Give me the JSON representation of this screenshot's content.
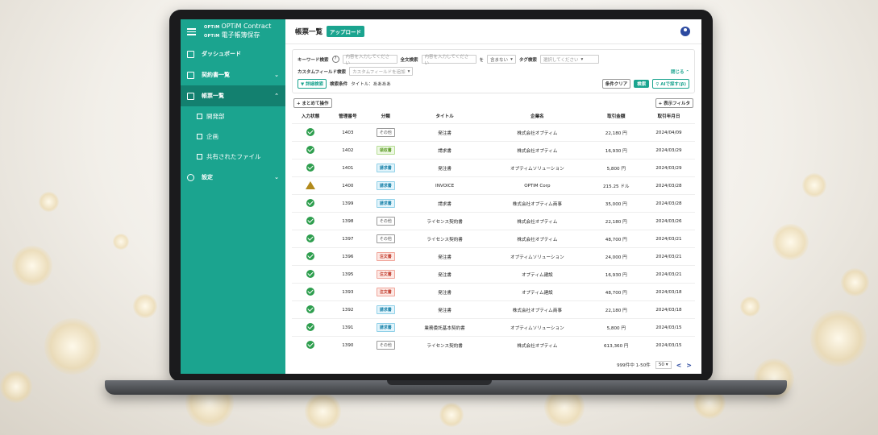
{
  "brand": {
    "logo_top": "OPTiM Contract",
    "logo_bottom": "電子帳簿保存",
    "prefix": "OPTiM"
  },
  "sidebar": {
    "items": [
      {
        "label": "ダッシュボード"
      },
      {
        "label": "契約書一覧"
      },
      {
        "label": "帳票一覧"
      },
      {
        "label": "設定"
      }
    ],
    "folders": [
      {
        "label": "開発部"
      },
      {
        "label": "企画"
      },
      {
        "label": "共有されたファイル"
      }
    ]
  },
  "header": {
    "title": "帳票一覧",
    "upload": "アップロード"
  },
  "search": {
    "keyword_label": "キーワード検索",
    "keyword_placeholder": "内容を入力してください",
    "fulltext_label": "全文検索",
    "fulltext_placeholder": "内容を入力してください",
    "wo": "を",
    "include_select": "含まない",
    "tag_label": "タグ検索",
    "tag_placeholder": "選択してください",
    "custom_label": "カスタムフィールド検索",
    "custom_placeholder": "カスタムフィールドを追加",
    "collapse": "閉じる",
    "advanced": "詳細検索",
    "conditions_label": "検索条件",
    "conditions_value": "タイトル：ああああ",
    "clear": "条件クリア",
    "search_btn": "検索",
    "ai_search": "AIで探す(β)"
  },
  "actions": {
    "bulk": "+ まとめて操作",
    "filter": "+ 表示フィルタ"
  },
  "table": {
    "headers": [
      "入力状態",
      "管理番号",
      "分類",
      "タイトル",
      "企業名",
      "取引金額",
      "取引年月日"
    ],
    "rows": [
      {
        "status": "ok",
        "id": "1403",
        "cat": "その他",
        "type": "other",
        "title": "発注書",
        "company": "株式会社オプティム",
        "amount": "22,180 円",
        "date": "2024/04/09"
      },
      {
        "status": "ok",
        "id": "1402",
        "cat": "領収書",
        "type": "receipt",
        "title": "請求書",
        "company": "株式会社オプティム",
        "amount": "16,930 円",
        "date": "2024/03/29"
      },
      {
        "status": "ok",
        "id": "1401",
        "cat": "請求書",
        "type": "bill",
        "title": "発注書",
        "company": "オプティムソリューション",
        "amount": "5,800 円",
        "date": "2024/03/29"
      },
      {
        "status": "warn",
        "id": "1400",
        "cat": "請求書",
        "type": "bill",
        "title": "INVOICE",
        "company": "OPTiM Corp",
        "amount": "215.25 ドル",
        "date": "2024/03/28"
      },
      {
        "status": "ok",
        "id": "1399",
        "cat": "請求書",
        "type": "bill",
        "title": "請求書",
        "company": "株式会社オプティム商事",
        "amount": "35,000 円",
        "date": "2024/03/28"
      },
      {
        "status": "ok",
        "id": "1398",
        "cat": "その他",
        "type": "other",
        "title": "ライセンス契約書",
        "company": "株式会社オプティム",
        "amount": "22,180 円",
        "date": "2024/03/26"
      },
      {
        "status": "ok",
        "id": "1397",
        "cat": "その他",
        "type": "other",
        "title": "ライセンス契約書",
        "company": "株式会社オプティム",
        "amount": "48,700 円",
        "date": "2024/03/21"
      },
      {
        "status": "ok",
        "id": "1396",
        "cat": "注文書",
        "type": "order",
        "title": "発注書",
        "company": "オプティムソリューション",
        "amount": "24,000 円",
        "date": "2024/03/21"
      },
      {
        "status": "ok",
        "id": "1395",
        "cat": "注文書",
        "type": "order",
        "title": "発注書",
        "company": "オプティム建設",
        "amount": "16,930 円",
        "date": "2024/03/21"
      },
      {
        "status": "ok",
        "id": "1393",
        "cat": "注文書",
        "type": "order",
        "title": "発注書",
        "company": "オプティム建設",
        "amount": "48,700 円",
        "date": "2024/03/18"
      },
      {
        "status": "ok",
        "id": "1392",
        "cat": "請求書",
        "type": "bill",
        "title": "発注書",
        "company": "株式会社オプティム商事",
        "amount": "22,180 円",
        "date": "2024/03/18"
      },
      {
        "status": "ok",
        "id": "1391",
        "cat": "請求書",
        "type": "bill",
        "title": "業務委託基本契約書",
        "company": "オプティムソリューション",
        "amount": "5,800 円",
        "date": "2024/03/15"
      },
      {
        "status": "ok",
        "id": "1390",
        "cat": "その他",
        "type": "other",
        "title": "ライセンス契約書",
        "company": "株式会社オプティム",
        "amount": "613,360 円",
        "date": "2024/03/15"
      }
    ]
  },
  "pagination": {
    "summary": "999件中 1-50件",
    "per_page": "50",
    "prev": "<",
    "next": ">"
  },
  "colors": {
    "accent": "#1ba48f",
    "accent_dark": "#13806f",
    "ok": "#2e9e4e",
    "warn": "#b28a1c"
  }
}
